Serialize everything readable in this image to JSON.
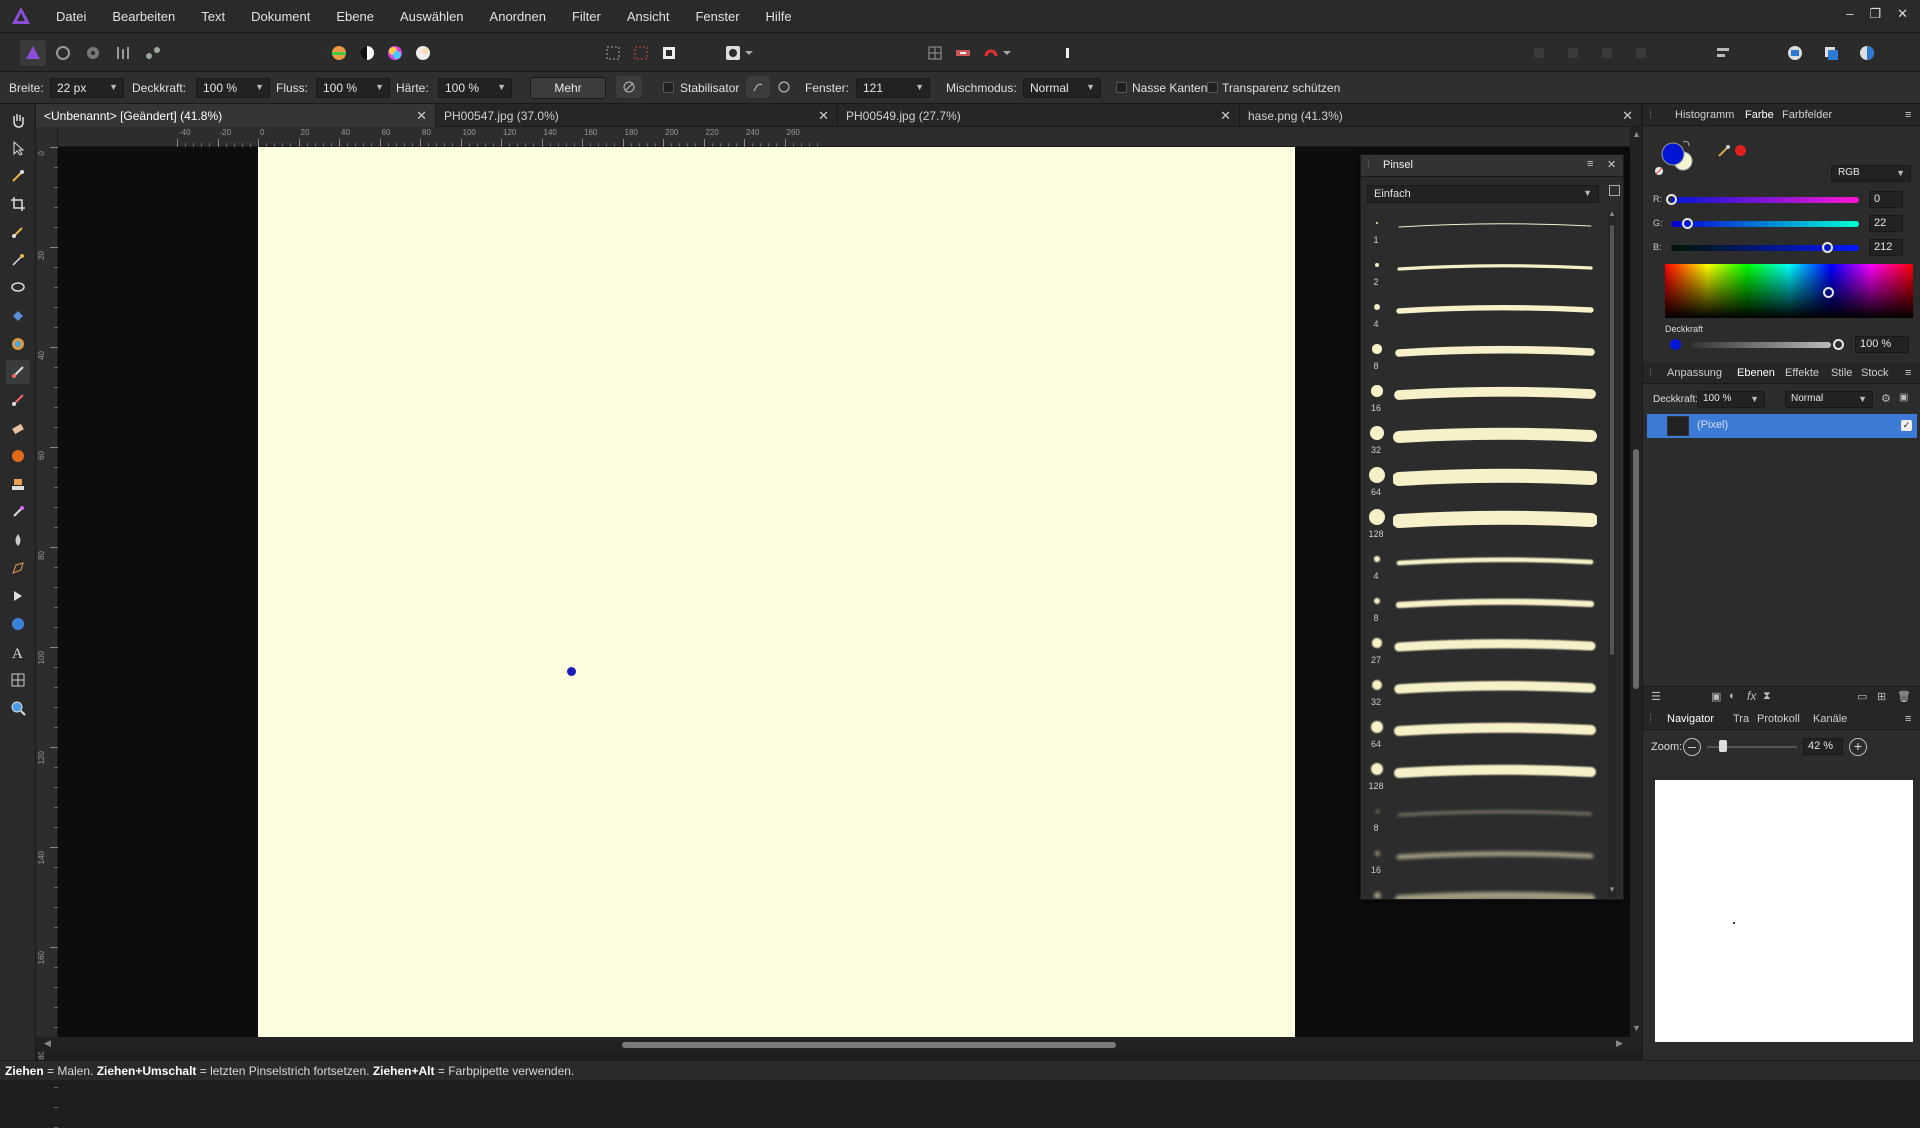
{
  "menu": [
    "Datei",
    "Bearbeiten",
    "Text",
    "Dokument",
    "Ebene",
    "Auswählen",
    "Anordnen",
    "Filter",
    "Ansicht",
    "Fenster",
    "Hilfe"
  ],
  "window_controls": [
    "–",
    "❐",
    "✕"
  ],
  "context": {
    "breite_label": "Breite:",
    "breite_value": "22 px",
    "deckkraft_label": "Deckkraft:",
    "deckkraft_value": "100 %",
    "fluss_label": "Fluss:",
    "fluss_value": "100 %",
    "haerte_label": "Härte:",
    "haerte_value": "100 %",
    "mehr_label": "Mehr",
    "stabilisator_label": "Stabilisator",
    "fenster_label": "Fenster:",
    "fenster_value": "121",
    "mischmodus_label": "Mischmodus:",
    "mischmodus_value": "Normal",
    "nasse_kanten_label": "Nasse Kanten",
    "transparenz_label": "Transparenz schützen"
  },
  "tabs": [
    {
      "label": "<Unbenannt> [Geändert] (41.8%)"
    },
    {
      "label": "PH00547.jpg (37.0%)"
    },
    {
      "label": "PH00549.jpg (27.7%)"
    },
    {
      "label": "hase.png (41.3%)"
    }
  ],
  "ruler": {
    "unit": "mm",
    "h_ticks": [
      "-40",
      "-20",
      "0",
      "20",
      "40",
      "60",
      "80",
      "100",
      "120",
      "140",
      "160",
      "180",
      "200",
      "220",
      "240",
      "260"
    ],
    "v_ticks": [
      "0",
      "20",
      "40",
      "60",
      "80",
      "100",
      "120",
      "140",
      "160",
      "180"
    ]
  },
  "brush_panel": {
    "title": "Pinsel",
    "category": "Einfach",
    "sizes": [
      "1",
      "2",
      "4",
      "8",
      "16",
      "32",
      "64",
      "128",
      "4",
      "8",
      "27",
      "32",
      "64",
      "128",
      "8",
      "16",
      ""
    ]
  },
  "color_panel": {
    "tabs": [
      "Histogramm",
      "Farbe",
      "Farbfelder"
    ],
    "mode": "RGB",
    "r_label": "R:",
    "r_value": "0",
    "g_label": "G:",
    "g_value": "22",
    "b_label": "B:",
    "b_value": "212",
    "opacity_label": "Deckkraft",
    "opacity_value": "100 %",
    "primary_color": "#0016d4"
  },
  "layers_panel": {
    "tabs": [
      "Anpassung",
      "Ebenen",
      "Effekte",
      "Stile",
      "Stock"
    ],
    "deckkraft_label": "Deckkraft:",
    "deckkraft_value": "100 %",
    "blend_value": "Normal",
    "layer_name": "(Pixel)"
  },
  "navigator_panel": {
    "tabs": [
      "Navigator",
      "Tra",
      "Protokoll",
      "Kanäle"
    ],
    "zoom_label": "Zoom:",
    "zoom_value": "42 %"
  },
  "status": {
    "p1b": "Ziehen",
    "p1": " = Malen. ",
    "p2b": "Ziehen+Umschalt",
    "p2": " = letzten Pinselstrich fortsetzen. ",
    "p3b": "Ziehen+Alt",
    "p3": " = Farbpipette verwenden."
  }
}
